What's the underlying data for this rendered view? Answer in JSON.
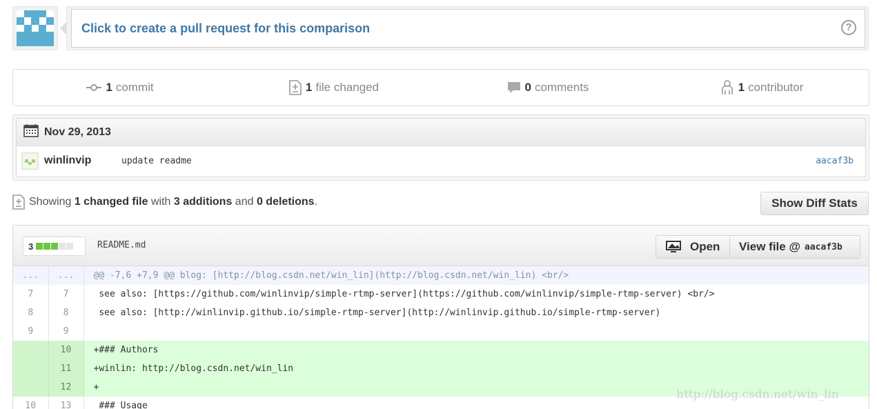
{
  "pull_request": {
    "text": "Click to create a pull request for this comparison",
    "help_glyph": "?"
  },
  "stats": {
    "commits": {
      "count": "1",
      "label": "commit"
    },
    "files": {
      "count": "1",
      "label": "file changed"
    },
    "comments": {
      "count": "0",
      "label": "comments"
    },
    "contributors": {
      "count": "1",
      "label": "contributor"
    }
  },
  "commit_group": {
    "date": "Nov 29, 2013",
    "commits": [
      {
        "author": "winlinvip",
        "message": "update readme",
        "sha": "aacaf3b"
      }
    ]
  },
  "summary": {
    "showing": "Showing",
    "changed_files": "1 changed file",
    "with": "with",
    "additions": "3 additions",
    "and": "and",
    "deletions": "0 deletions",
    "period": "."
  },
  "diff_stats_button": "Show Diff Stats",
  "file": {
    "diffstat_count": "3",
    "diffstat_blocks": {
      "added": 3,
      "total": 5
    },
    "name": "README.md",
    "open_label": "Open",
    "view_label": "View file @",
    "view_sha": "aacaf3b",
    "lines": [
      {
        "type": "hunk",
        "old": "...",
        "new": "...",
        "text": "@@ -7,6 +7,9 @@ blog: [http://blog.csdn.net/win_lin](http://blog.csdn.net/win_lin) <br/>"
      },
      {
        "type": "context",
        "old": "7",
        "new": "7",
        "text": " see also: [https://github.com/winlinvip/simple-rtmp-server](https://github.com/winlinvip/simple-rtmp-server) <br/>"
      },
      {
        "type": "context",
        "old": "8",
        "new": "8",
        "text": " see also: [http://winlinvip.github.io/simple-rtmp-server](http://winlinvip.github.io/simple-rtmp-server)"
      },
      {
        "type": "context",
        "old": "9",
        "new": "9",
        "text": " "
      },
      {
        "type": "added",
        "old": "",
        "new": "10",
        "text": "+### Authors"
      },
      {
        "type": "added",
        "old": "",
        "new": "11",
        "text": "+winlin: http://blog.csdn.net/win_lin"
      },
      {
        "type": "added",
        "old": "",
        "new": "12",
        "text": "+"
      },
      {
        "type": "context",
        "old": "10",
        "new": "13",
        "text": " ### Usage"
      }
    ]
  },
  "watermark": "http://blog.csdn.net/win_lin",
  "colors": {
    "link": "#3f78a6",
    "added_bg": "#dbffdb",
    "hunk_bg": "#f3f5fc",
    "diffstat_add": "#6cc644"
  }
}
